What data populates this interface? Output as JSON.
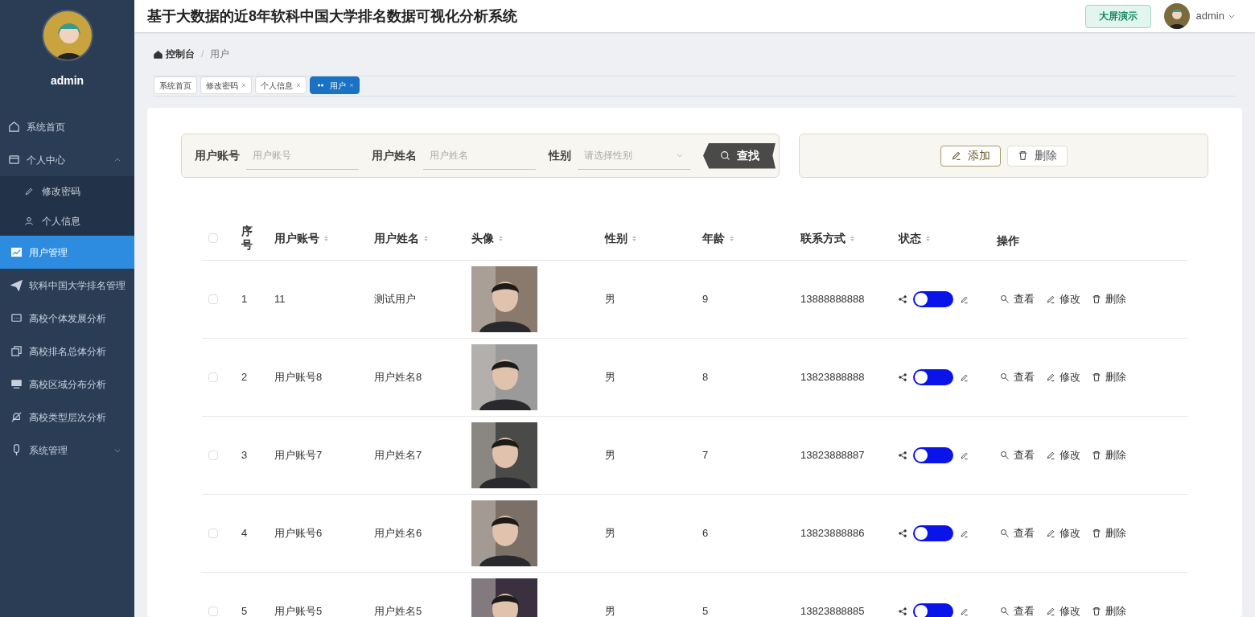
{
  "sidebar": {
    "user": "admin",
    "items": [
      {
        "label": "系统首页",
        "selected": false
      },
      {
        "label": "个人中心",
        "selected": false,
        "expanded": true,
        "children": [
          {
            "label": "修改密码",
            "selected": false
          },
          {
            "label": "个人信息",
            "selected": false
          }
        ]
      },
      {
        "label": "用户管理",
        "selected": true
      },
      {
        "label": "软科中国大学排名管理",
        "selected": false
      },
      {
        "label": "高校个体发展分析",
        "selected": false
      },
      {
        "label": "高校排名总体分析",
        "selected": false
      },
      {
        "label": "高校区域分布分析",
        "selected": false
      },
      {
        "label": "高校类型层次分析",
        "selected": false
      },
      {
        "label": "系统管理",
        "selected": false,
        "expanded": false
      }
    ]
  },
  "header": {
    "title": "基于大数据的近8年软科中国大学排名数据可视化分析系统",
    "screen_button": "大屏演示",
    "user": "admin"
  },
  "breadcrumb": {
    "separator": "/",
    "items": [
      "控制台",
      "用户"
    ]
  },
  "tabs": [
    {
      "label": "系统首页",
      "closable": false,
      "selected": false
    },
    {
      "label": "修改密码",
      "closable": true,
      "selected": false
    },
    {
      "label": "个人信息",
      "closable": true,
      "selected": false
    },
    {
      "label": "用户",
      "closable": true,
      "selected": true
    }
  ],
  "search": {
    "fields": [
      {
        "label": "用户账号",
        "placeholder": "用户账号",
        "kind": "text"
      },
      {
        "label": "用户姓名",
        "placeholder": "用户姓名",
        "kind": "text"
      },
      {
        "label": "性别",
        "placeholder": "请选择性别",
        "kind": "select"
      }
    ],
    "button": "查找"
  },
  "actions": [
    {
      "label": "添加",
      "kind": "add"
    },
    {
      "label": "删除",
      "kind": "delete"
    }
  ],
  "table": {
    "columns": [
      {
        "label": "序号",
        "sortable": false
      },
      {
        "label": "用户账号",
        "sortable": true
      },
      {
        "label": "用户姓名",
        "sortable": true
      },
      {
        "label": "头像",
        "sortable": true
      },
      {
        "label": "性别",
        "sortable": true
      },
      {
        "label": "年龄",
        "sortable": true
      },
      {
        "label": "联系方式",
        "sortable": true
      },
      {
        "label": "状态",
        "sortable": true
      },
      {
        "label": "操作",
        "sortable": false
      }
    ],
    "all_checked": false,
    "rows": [
      {
        "index": "1",
        "account": "11",
        "name": "测试用户",
        "gender": "男",
        "age": "9",
        "phone": "13888888888",
        "on": false,
        "checked": false,
        "actions": [
          "查看",
          "修改",
          "删除"
        ]
      },
      {
        "index": "2",
        "account": "用户账号8",
        "name": "用户姓名8",
        "gender": "男",
        "age": "8",
        "phone": "13823888888",
        "on": false,
        "checked": false,
        "actions": [
          "查看",
          "修改",
          "删除"
        ]
      },
      {
        "index": "3",
        "account": "用户账号7",
        "name": "用户姓名7",
        "gender": "男",
        "age": "7",
        "phone": "13823888887",
        "on": false,
        "checked": false,
        "actions": [
          "查看",
          "修改",
          "删除"
        ]
      },
      {
        "index": "4",
        "account": "用户账号6",
        "name": "用户姓名6",
        "gender": "男",
        "age": "6",
        "phone": "13823888886",
        "on": false,
        "checked": false,
        "actions": [
          "查看",
          "修改",
          "删除"
        ]
      },
      {
        "index": "5",
        "account": "用户账号5",
        "name": "用户姓名5",
        "gender": "男",
        "age": "5",
        "phone": "13823888885",
        "on": false,
        "checked": false,
        "actions": [
          "查看",
          "修改",
          "删除"
        ]
      }
    ]
  }
}
